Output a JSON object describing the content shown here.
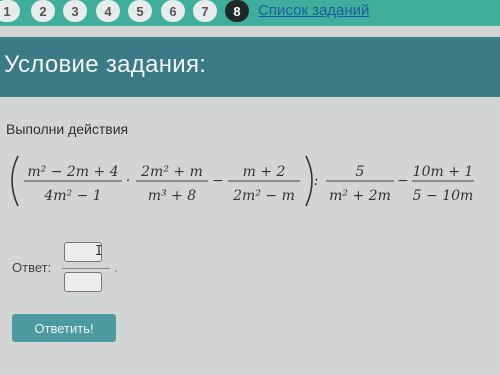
{
  "nav": {
    "questions": [
      {
        "label": "1",
        "current": false
      },
      {
        "label": "2",
        "current": false
      },
      {
        "label": "3",
        "current": false
      },
      {
        "label": "4",
        "current": false
      },
      {
        "label": "5",
        "current": false
      },
      {
        "label": "6",
        "current": false
      },
      {
        "label": "7",
        "current": false
      },
      {
        "label": "8",
        "current": true
      }
    ],
    "list_link": "Список заданий"
  },
  "title": "Условие задания:",
  "instruction": "Выполни действия",
  "expression": {
    "f1_num": "m² − 2m + 4",
    "f1_den": "4m² − 1",
    "op1": "·",
    "f2_num": "2m² + m",
    "f2_den": "m³ + 8",
    "op2": "−",
    "f3_num": "m + 2",
    "f3_den": "2m² − m",
    "op3": ":",
    "f4_num": "5",
    "f4_den": "m² + 2m",
    "op4": "−",
    "f5_num": "10m + 1",
    "f5_den": "5 − 10m"
  },
  "answer_label": "Ответ:",
  "cursor_glyph": "I",
  "submit_label": "Ответить!"
}
